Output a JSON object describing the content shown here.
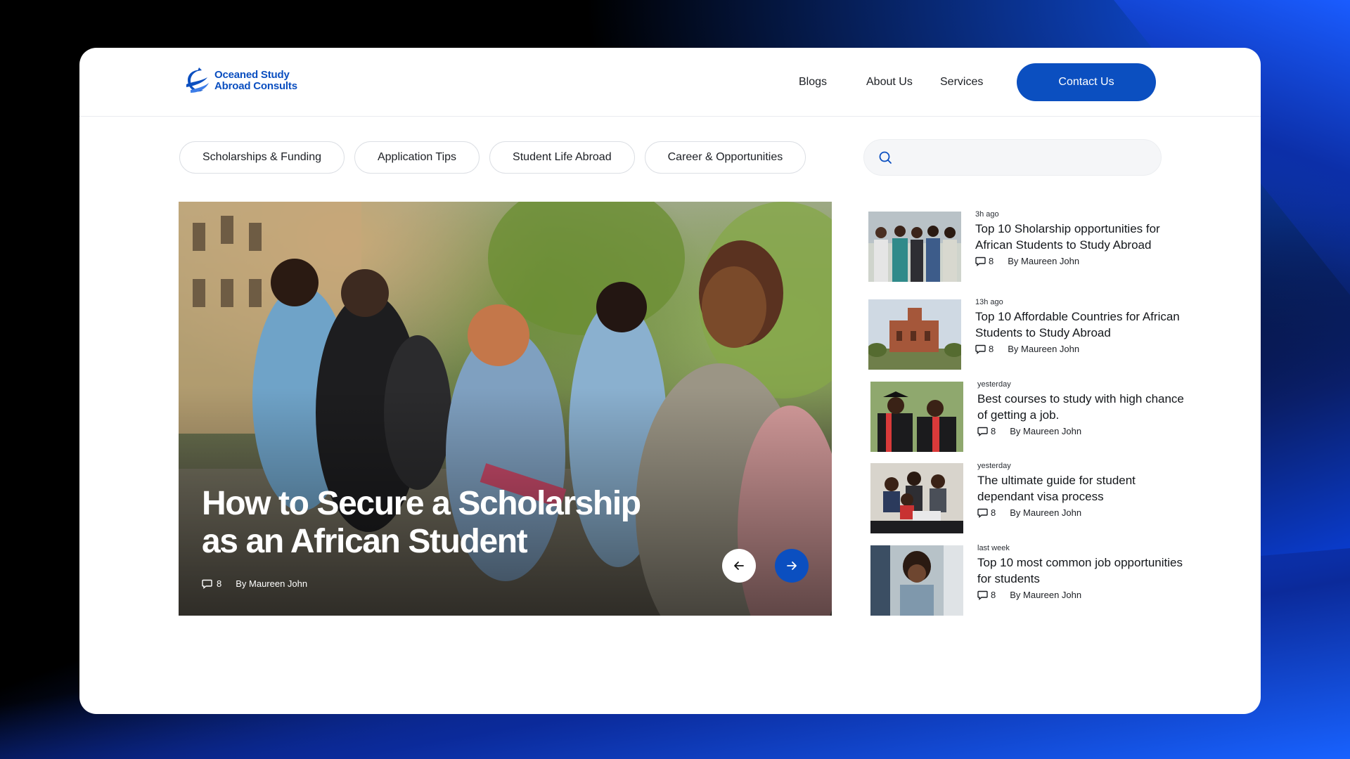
{
  "brand": {
    "name_line1": "Oceaned Study",
    "name_line2": "Abroad Consults",
    "color": "#0b4fc0"
  },
  "nav": {
    "blogs": "Blogs",
    "about": "About Us",
    "services": "Services",
    "contact": "Contact Us"
  },
  "filters": [
    "Scholarships & Funding",
    "Application Tips",
    "Student Life Abroad",
    "Career & Opportunities"
  ],
  "search": {
    "placeholder": "",
    "icon": "search-icon"
  },
  "hero": {
    "title_line1": "How to Secure a Scholarship",
    "title_line2": "as an African Student",
    "comments": "8",
    "author": "By Maureen John"
  },
  "posts": [
    {
      "time": "3h ago",
      "title": "Top 10 Sholarship opportunities for African Students to Study Abroad",
      "comments": "8",
      "author": "By Maureen John"
    },
    {
      "time": "13h ago",
      "title": "Top 10 Affordable Countries for African Students to Study Abroad",
      "comments": "8",
      "author": "By Maureen John"
    },
    {
      "time": "yesterday",
      "title": "Best courses to study with high chance of getting a job.",
      "comments": "8",
      "author": "By Maureen John"
    },
    {
      "time": "yesterday",
      "title": "The ultimate guide for student dependant visa process",
      "comments": "8",
      "author": "By Maureen John"
    },
    {
      "time": "last week",
      "title": "Top 10 most common job opportunities for students",
      "comments": "8",
      "author": "By Maureen John"
    }
  ]
}
